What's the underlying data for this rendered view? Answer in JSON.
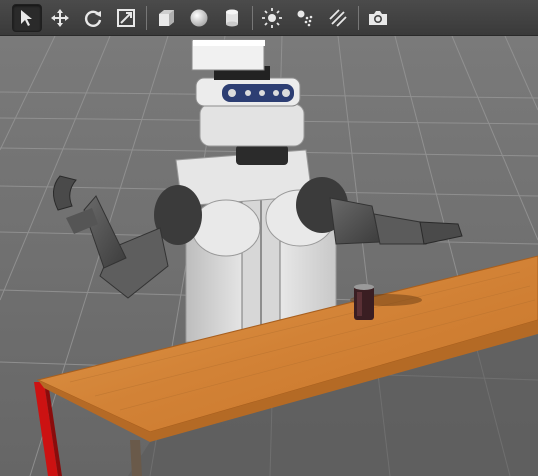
{
  "toolbar": {
    "tools": [
      {
        "name": "select-mode",
        "icon": "arrow-cursor-icon",
        "active": true
      },
      {
        "name": "translate-mode",
        "icon": "move-arrows-icon",
        "active": false
      },
      {
        "name": "rotate-mode",
        "icon": "rotate-icon",
        "active": false
      },
      {
        "name": "scale-mode",
        "icon": "scale-icon",
        "active": false
      },
      {
        "name": "insert-box",
        "icon": "box-icon",
        "active": false
      },
      {
        "name": "insert-sphere",
        "icon": "sphere-icon",
        "active": false
      },
      {
        "name": "insert-cylinder",
        "icon": "cylinder-icon",
        "active": false
      },
      {
        "name": "point-light",
        "icon": "sun-icon",
        "active": false
      },
      {
        "name": "spot-light",
        "icon": "spot-light-icon",
        "active": false
      },
      {
        "name": "directional-light",
        "icon": "directional-light-icon",
        "active": false
      },
      {
        "name": "screenshot",
        "icon": "camera-icon",
        "active": false
      }
    ]
  },
  "scene": {
    "objects": [
      "robot",
      "table",
      "soda-can"
    ],
    "colors": {
      "ground": "#6f6f6f",
      "grid": "#8e8e8e",
      "table_top": "#d7883d",
      "table_leg": "#cc1212",
      "can": "#3a1e22"
    }
  }
}
